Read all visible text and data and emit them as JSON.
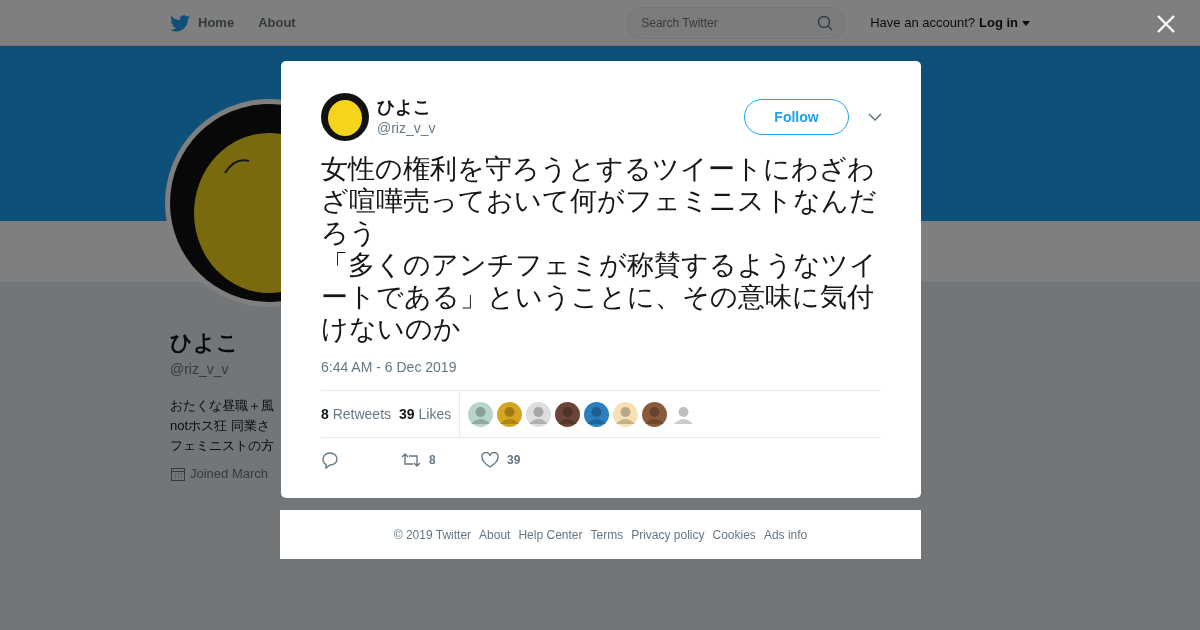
{
  "nav": {
    "items": [
      {
        "label": "Home"
      },
      {
        "label": "About"
      }
    ],
    "search": {
      "placeholder": "Search Twitter"
    },
    "account_prompt": "Have an account?",
    "login": "Log in"
  },
  "profile": {
    "name": "ひよこ",
    "handle": "@riz_v_v",
    "bio_lines": [
      "おたくな昼職＋風",
      "notホス狂 同業さ",
      "フェミニストの方"
    ],
    "joined": "Joined March"
  },
  "tweet": {
    "name": "ひよこ",
    "handle": "@riz_v_v",
    "follow": "Follow",
    "text_paragraphs": [
      "女性の権利を守ろうとするツイートにわざわざ喧嘩売っておいて何がフェミニストなんだろう",
      "「多くのアンチフェミが称賛するようなツイートである」ということに、その意味に気付けないのか"
    ],
    "time": "6:44 AM - 6 Dec 2019",
    "retweets": {
      "count": "8",
      "label": "Retweets"
    },
    "likes": {
      "count": "39",
      "label": "Likes"
    },
    "likers": [
      {
        "kind": "picture"
      },
      {
        "kind": "picture"
      },
      {
        "kind": "picture"
      },
      {
        "kind": "picture"
      },
      {
        "kind": "picture"
      },
      {
        "kind": "picture"
      },
      {
        "kind": "picture"
      },
      {
        "kind": "picture"
      }
    ],
    "actions": [
      {
        "kind": "reply"
      },
      {
        "kind": "retweet",
        "count": "8"
      },
      {
        "kind": "like",
        "count": "39"
      }
    ]
  },
  "footer": [
    "© 2019 Twitter",
    "About",
    "Help Center",
    "Terms",
    "Privacy policy",
    "Cookies",
    "Ads info"
  ]
}
